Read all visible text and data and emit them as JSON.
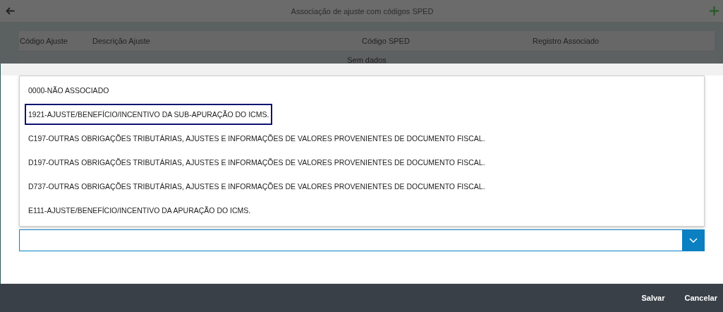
{
  "window": {
    "title": "Associação de ajuste com códigos SPED"
  },
  "table": {
    "columns": [
      "Código Ajuste",
      "Descrição Ajuste",
      "Código SPED",
      "Registro Associado"
    ],
    "empty_text": "Sem dados"
  },
  "dropdown": {
    "options": [
      {
        "label": "0000-NÃO ASSOCIADO",
        "selected": false
      },
      {
        "label": "1921-AJUSTE/BENEFÍCIO/INCENTIVO DA SUB-APURAÇÃO DO ICMS.",
        "selected": true
      },
      {
        "label": "C197-OUTRAS OBRIGAÇÕES TRIBUTÁRIAS, AJUSTES E INFORMAÇÕES DE VALORES PROVENIENTES DE DOCUMENTO FISCAL.",
        "selected": false
      },
      {
        "label": "D197-OUTRAS OBRIGAÇÕES TRIBUTÁRIAS, AJUSTES E INFORMAÇÕES DE VALORES PROVENIENTES DE DOCUMENTO FISCAL.",
        "selected": false
      },
      {
        "label": "D737-OUTRAS OBRIGAÇÕES TRIBUTÁRIAS, AJUSTES E INFORMAÇÕES DE VALORES PROVENIENTES DE DOCUMENTO FISCAL.",
        "selected": false
      },
      {
        "label": "E111-AJUSTE/BENEFÍCIO/INCENTIVO DA APURAÇÃO DO ICMS.",
        "selected": false
      }
    ]
  },
  "buttons": [
    "Salvar",
    "Cancelar"
  ]
}
